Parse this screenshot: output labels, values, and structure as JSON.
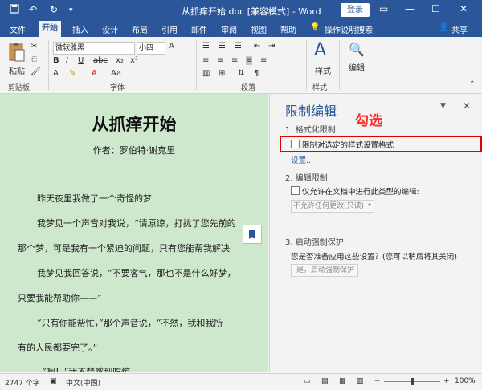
{
  "titlebar": {
    "title": "从抓痒开始.doc [兼容模式] - Word",
    "login_label": "登录",
    "quick_access": [
      "save-icon",
      "undo-icon",
      "redo-icon"
    ]
  },
  "tabs": [
    {
      "label": "文件"
    },
    {
      "label": "开始"
    },
    {
      "label": "插入"
    },
    {
      "label": "设计"
    },
    {
      "label": "布局"
    },
    {
      "label": "引用"
    },
    {
      "label": "邮件"
    },
    {
      "label": "审阅"
    },
    {
      "label": "视图"
    },
    {
      "label": "帮助"
    }
  ],
  "tab_extra": {
    "search_label": "操作说明搜索",
    "share_label": "共享"
  },
  "ribbon": {
    "paste_label": "粘贴",
    "clipboard_label": "剪贴板",
    "font_name": "微软雅黑",
    "font_size": "小四",
    "font_group_label": "字体",
    "paragraph_label": "段落",
    "styles_label": "样式",
    "styles_group_label": "样式",
    "edit_label": "编辑"
  },
  "document": {
    "title": "从抓痒开始",
    "author": "作者：罗伯特·谢克里",
    "lines": [
      "昨天夜里我做了一个奇怪的梦",
      "我梦见一个声音对我说，“请原谅，打扰了您先前的",
      "那个梦，可是我有一个紧迫的问题，只有您能帮我解决",
      "我梦见我回答说，“不要客气，那也不是什么好梦，",
      "只要我能帮助你——”",
      "“只有你能帮忙，”那个声音说，“不然，我和我所",
      "有的人民都要完了。”",
      "“啊！”我不禁感到吃惊。"
    ]
  },
  "pane": {
    "title": "限制编辑",
    "annotation": "勾选",
    "section1_heading": "1. 格式化限制",
    "format_restrict_label": "限制对选定的样式设置格式",
    "settings_link": "设置...",
    "section2_heading": "2. 编辑限制",
    "edit_restrict_label": "仅允许在文档中进行此类型的编辑:",
    "edit_dropdown_value": "不允许任何更改(只读)",
    "section3_heading": "3. 启动强制保护",
    "enforce_question": "您是否准备应用这些设置？(您可以稍后将其关闭)",
    "enforce_button": "是，启动强制保护"
  },
  "status": {
    "word_count": "2747 个字",
    "language": "中文(中国)",
    "zoom": "100%"
  },
  "colors": {
    "accent": "#2b579a",
    "doc_bg": "#cde8cd",
    "highlight": "#e00000",
    "annotation": "#ff2a2a"
  }
}
